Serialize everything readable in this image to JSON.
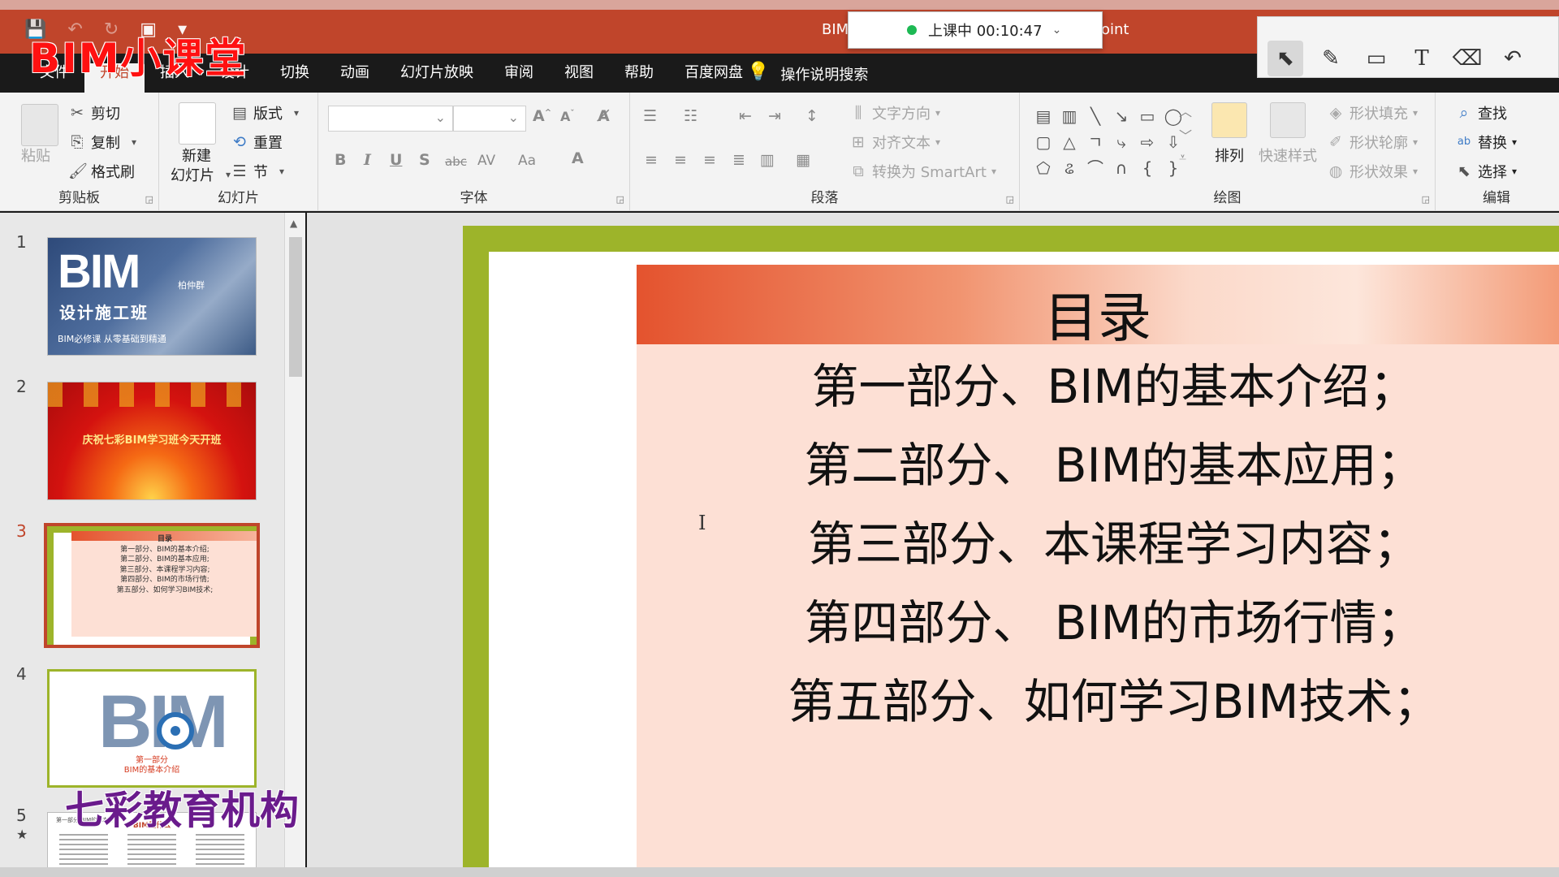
{
  "app": {
    "window_title_start": "BIM",
    "window_title_end": "oint",
    "accent": "#c0452b"
  },
  "watermarks": {
    "top": "BIM小课堂",
    "bottom": "七彩教育机构"
  },
  "class_timer": {
    "label": "上课中 00:10:47",
    "status_color": "#1db954"
  },
  "tabs": [
    "文件",
    "开始",
    "插入",
    "设计",
    "切换",
    "动画",
    "幻灯片放映",
    "审阅",
    "视图",
    "帮助",
    "百度网盘"
  ],
  "active_tab": "开始",
  "tell_me": "操作说明搜索",
  "pen_toolbar": [
    "select-arrow-icon",
    "pen-icon",
    "rectangle-icon",
    "text-icon",
    "eraser-icon",
    "undo-icon"
  ],
  "ribbon": {
    "clipboard": {
      "label": "剪贴板",
      "paste": "粘贴",
      "cut": "剪切",
      "copy": "复制",
      "format_painter": "格式刷"
    },
    "slides": {
      "label": "幻灯片",
      "new_slide_line1": "新建",
      "new_slide_line2": "幻灯片",
      "layout": "版式",
      "reset": "重置",
      "section": "节"
    },
    "font": {
      "label": "字体",
      "bold": "B",
      "italic": "I",
      "underline": "U",
      "shadow": "S",
      "strike": "abc",
      "spacing": "AV",
      "case": "Aa",
      "color": "A"
    },
    "paragraph": {
      "label": "段落",
      "text_direction": "文字方向",
      "align_text": "对齐文本",
      "smartart": "转换为 SmartArt"
    },
    "drawing": {
      "label": "绘图",
      "arrange": "排列",
      "quick_styles": "快速样式",
      "shape_fill": "形状填充",
      "shape_outline": "形状轮廓",
      "shape_effects": "形状效果"
    },
    "editing": {
      "label": "编辑",
      "find": "查找",
      "replace": "替换",
      "select": "选择"
    }
  },
  "thumbnails": [
    {
      "num": "1",
      "bim": "BIM",
      "subtitle": "设计施工班",
      "tag": "柏仲群",
      "footer": "BIM必修课 从零基础到精通"
    },
    {
      "num": "2",
      "text": "庆祝七彩BIM学习班今天开班"
    },
    {
      "num": "3",
      "title": "目录",
      "lines": [
        "第一部分、BIM的基本介绍;",
        "第二部分、BIM的基本应用;",
        "第三部分、本课程学习内容;",
        "第四部分、BIM的市场行情;",
        "第五部分、如何学习BIM技术;"
      ]
    },
    {
      "num": "4",
      "big": "BIM",
      "caption1": "第一部分",
      "caption2": "BIM的基本介绍"
    },
    {
      "num": "5",
      "marker": "★",
      "header": "第一部分 BIM的基本介绍",
      "title": "BIM是什么"
    }
  ],
  "current_slide": 3,
  "slide": {
    "title": "目录",
    "lines": [
      "第一部分、BIM的基本介绍；",
      "第二部分、 BIM的基本应用；",
      "第三部分、本课程学习内容；",
      "第四部分、 BIM的市场行情；",
      "第五部分、如何学习BIM技术；"
    ]
  }
}
